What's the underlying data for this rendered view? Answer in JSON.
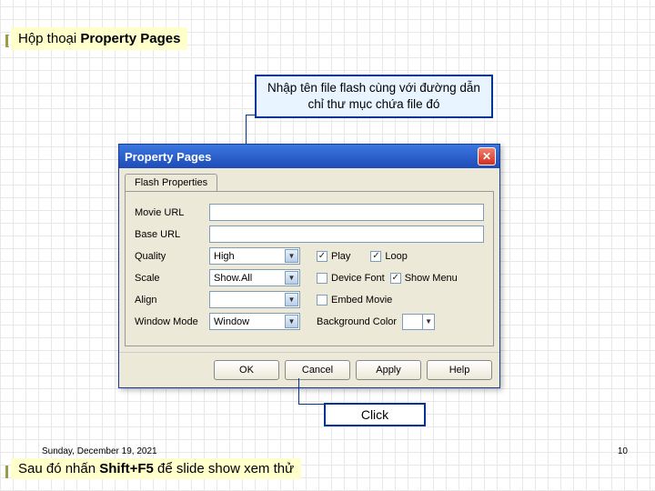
{
  "slide": {
    "title_plain": "Hộp thoại ",
    "title_bold": "Property Pages",
    "callout": "Nhập tên file flash cùng với đường dẫn chỉ thư mục chứa file đó",
    "click_label": "Click",
    "date": "Sunday, December 19, 2021",
    "footer_plain": "Sau đó nhấn ",
    "footer_bold": "Shift+F5",
    "footer_tail": " để slide show xem thử",
    "page_num": "10"
  },
  "dialog": {
    "title": "Property Pages",
    "tab": "Flash Properties",
    "labels": {
      "movie_url": "Movie URL",
      "base_url": "Base URL",
      "quality": "Quality",
      "scale": "Scale",
      "align": "Align",
      "window_mode": "Window Mode",
      "bg_color": "Background Color"
    },
    "values": {
      "quality": "High",
      "scale": "Show.All",
      "align": "",
      "window_mode": "Window"
    },
    "checks": {
      "play": "Play",
      "loop": "Loop",
      "device_font": "Device Font",
      "show_menu": "Show Menu",
      "embed_movie": "Embed Movie"
    },
    "buttons": {
      "ok": "OK",
      "cancel": "Cancel",
      "apply": "Apply",
      "help": "Help"
    }
  }
}
